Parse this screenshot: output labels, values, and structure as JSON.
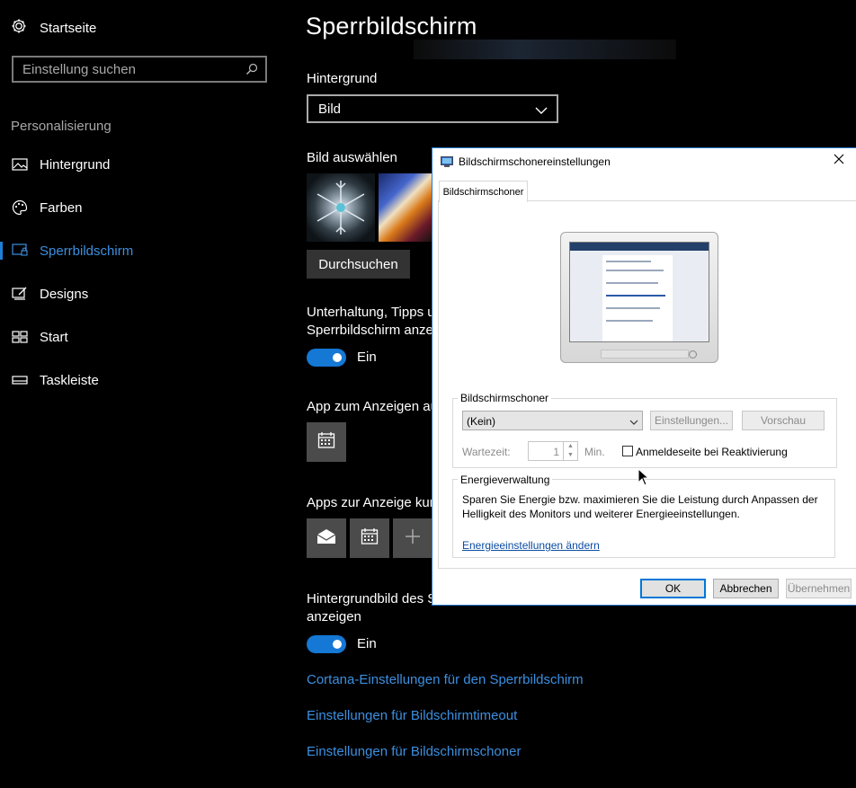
{
  "sidebar": {
    "home_label": "Startseite",
    "search_placeholder": "Einstellung suchen",
    "section_title": "Personalisierung",
    "items": [
      {
        "label": "Hintergrund",
        "icon": "image-icon"
      },
      {
        "label": "Farben",
        "icon": "palette-icon"
      },
      {
        "label": "Sperrbildschirm",
        "icon": "lock-screen-icon",
        "active": true
      },
      {
        "label": "Designs",
        "icon": "brush-icon"
      },
      {
        "label": "Start",
        "icon": "start-grid-icon"
      },
      {
        "label": "Taskleiste",
        "icon": "taskbar-icon"
      }
    ]
  },
  "main": {
    "title": "Sperrbildschirm",
    "background_label": "Hintergrund",
    "background_value": "Bild",
    "choose_picture_label": "Bild auswählen",
    "browse_button": "Durchsuchen",
    "tips_label_line1": "Unterhaltung, Tipps u",
    "tips_label_line2": "Sperrbildschirm anze",
    "toggle1_label": "Ein",
    "app_detail_label": "App zum Anzeigen au",
    "apps_quick_label": "Apps zur Anzeige kur",
    "signin_bg_label_line1": "Hintergrundbild des S",
    "signin_bg_label_line2": "anzeigen",
    "toggle2_label": "Ein",
    "links": [
      "Cortana-Einstellungen für den Sperrbildschirm",
      "Einstellungen für Bildschirmtimeout",
      "Einstellungen für Bildschirmschoner"
    ]
  },
  "dialog": {
    "title": "Bildschirmschonereinstellungen",
    "tab_label": "Bildschirmschoner",
    "screensaver_group_title": "Bildschirmschoner",
    "screensaver_value": "(Kein)",
    "settings_button": "Einstellungen...",
    "preview_button": "Vorschau",
    "wait_label": "Wartezeit:",
    "wait_value": "1",
    "minutes_label": "Min.",
    "resume_checkbox_label": "Anmeldeseite bei Reaktivierung",
    "power_group_title": "Energieverwaltung",
    "power_text_line1": "Sparen Sie Energie bzw. maximieren Sie die Leistung durch Anpassen der",
    "power_text_line2": "Helligkeit des Monitors und weiterer Energieeinstellungen.",
    "power_link": "Energieeinstellungen ändern",
    "ok_button": "OK",
    "cancel_button": "Abbrechen",
    "apply_button": "Übernehmen"
  },
  "colors": {
    "accent": "#1478d4",
    "link": "#3c8fe0",
    "background": "#000000"
  }
}
